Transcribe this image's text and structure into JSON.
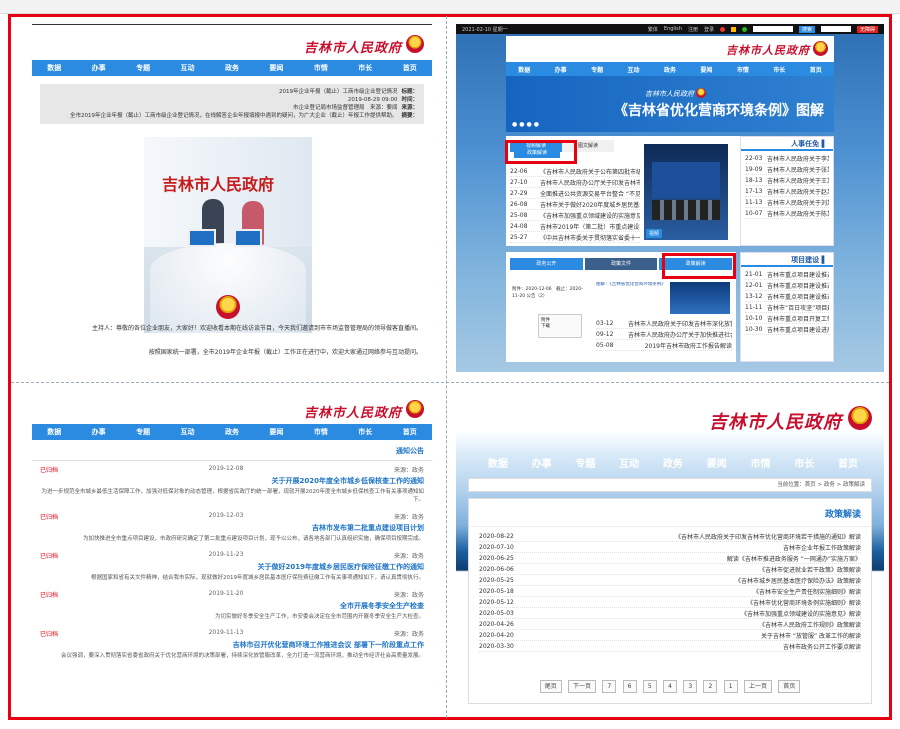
{
  "window": {
    "top_date": "2021-02-10 星期一"
  },
  "brand_name": "吉林市人民政府",
  "nav": [
    "首页",
    "市长",
    "市情",
    "要闻",
    "政务",
    "互动",
    "专题",
    "办事",
    "数据"
  ],
  "pane_tl": {
    "meta_labels": [
      "标题：",
      "时间：",
      "来源：",
      "摘要："
    ],
    "meta_values": [
      "2019年企业年报（截止）工商市级企业登记情况",
      "2019-08-29 09:00",
      "市企业登记局市场监督管理局　来源：要闻",
      "全市2019年企业年报（截止）工商市级企业登记情况，在线解答企业年报填报中遇到的疑问，为广大企业（截止）年报工作提供帮助。"
    ],
    "photo_sign": "吉林市人民政府",
    "para1": "主持人：尊敬的各位企业朋友，大家好！欢迎收看本期在线访谈节目，今天我们邀请到市市场监督管理局的领导做客直播间。",
    "para2": "按照国家统一部署，全市2019年企业年报（截止）工作正在进行中，欢迎大家通过网络参与互动提问。"
  },
  "pane_tr": {
    "top_links": [
      "无障碍",
      "长者版",
      "登录",
      "注册",
      "English",
      "繁体"
    ],
    "search_placeholder": "请输入关键字",
    "search_button": "搜索",
    "banner_caption": "《吉林省优化营商环境条例》图解",
    "left_tabs": [
      "政策解读",
      "图文解读",
      "视频解读"
    ],
    "news": [
      [
        "《吉林市人民政府关于公布第四批市级非物质文化遗产代表性项目名录的通知》",
        "22-06"
      ],
      [
        "吉林市人民政府办公厅关于印发吉林市优化营商环境工作方案的通知",
        "27-10"
      ],
      [
        "全面推进公共资源交易平台整合 “不见面”开标常态化",
        "27-29"
      ],
      [
        "吉林市关于做好2020年度城乡居民基本医疗保险参保工作的通知",
        "26-08"
      ],
      [
        "《吉林市加强重点领域建设的实施意见》政策解读",
        "25-08"
      ],
      [
        "吉林市2019年（第二批）市重点建设项目计划",
        "24-08"
      ],
      [
        "《中共吉林市委关于贯彻落实省委十一届五次全会精神的决定》",
        "25-27"
      ]
    ],
    "video_label": "视频",
    "side_title": "人事任免",
    "side_items": [
      [
        "吉林市人民政府关于李某某等同志职务任免的通知",
        "22-03"
      ],
      [
        "吉林市人民政府关于张某某等同志职务任免的通知",
        "19-09"
      ],
      [
        "吉林市人民政府关于王某某同志职务任免的通知",
        "18-13"
      ],
      [
        "吉林市人民政府关于赵某某等同志职务任免的通知",
        "17-13"
      ],
      [
        "吉林市人民政府关于刘某某等同志职务任免的通知",
        "11-13"
      ],
      [
        "吉林市人民政府关于陈某某同志职务任免的通知",
        "10-07"
      ]
    ],
    "tabs2": [
      "政务公开",
      "政策文件",
      "政策解读"
    ],
    "pill_label": "图解：《吉林省优化营商环境条例》",
    "tab2_items": [
      [
        "吉林市人民政府关于印发吉林市深化放管服改革工作方案的通知",
        "03-12"
      ],
      [
        "吉林市人民政府办公厅关于加快推进社会信用体系建设的实施意见",
        "09-12"
      ],
      [
        "2019年吉林市政府工作报告解读",
        "05-08"
      ]
    ],
    "mini_text": "附件：2020-12-06　截止：2020-11-20 公告（2）",
    "tiny_items": [
      "附件",
      "下载"
    ],
    "side2_title": "项目建设",
    "side2_items": [
      [
        "吉林市重点项目建设推进情况通报（第一期）",
        "21-01"
      ],
      [
        "吉林市重点项目建设推进情况通报（第二期）",
        "12-01"
      ],
      [
        "吉林市重点项目建设推进情况通报（第三期）",
        "13-12"
      ],
      [
        "吉林市“百日攻坚”项目建设成效显著",
        "11-11"
      ],
      [
        "吉林市重点项目开复工情况通报",
        "10-10"
      ],
      [
        "吉林市重点项目建设进展情况",
        "10-30"
      ]
    ]
  },
  "pane_bl": {
    "section_title": "通知公告",
    "tag": "已归档",
    "articles": [
      {
        "title": "关于开展2020年度全市城乡低保核查工作的通知",
        "source": "来源：政务",
        "date": "2019-12-08",
        "body": "为进一步规范全市城乡最低生活保障工作，加强对低保对象的动态管理，根据省民政厅的统一部署，现就开展2020年度全市城乡低保核查工作有关事项通知如下。"
      },
      {
        "title": "吉林市发布第二批重点建设项目计划",
        "source": "来源：政务",
        "date": "2019-12-03",
        "body": "为加快推进全市重点项目建设，市政府研究确定了第二批重点建设项目计划，现予以公布，请各地各部门认真组织实施，确保项目按期完成。"
      },
      {
        "title": "关于做好2019年度城乡居民医疗保险征缴工作的通知",
        "source": "来源：政务",
        "date": "2019-11-23",
        "body": "根据国家和省有关文件精神，结合我市实际，现就做好2019年度城乡居民基本医疗保险费征缴工作有关事项通知如下，请认真贯彻执行。"
      },
      {
        "title": "全市开展冬季安全生产检查",
        "source": "来源：政务",
        "date": "2019-11-20",
        "body": "为切实做好冬季安全生产工作，市安委会决定在全市范围内开展冬季安全生产大检查。"
      },
      {
        "title": "吉林市召开优化营商环境工作推进会议 部署下一阶段重点工作",
        "source": "来源：政务",
        "date": "2019-11-13",
        "body": "会议强调，要深入贯彻落实省委省政府关于优化营商环境的决策部署，持续深化放管服改革，全力打造一流营商环境，推动全市经济社会高质量发展。"
      }
    ]
  },
  "pane_br": {
    "crumb": "当前位置：首页 > 政务 > 政策解读",
    "list_title": "政策解读",
    "list": [
      [
        "《吉林市人民政府关于印发吉林市优化营商环境若干措施的通知》解读",
        "2020-08-22"
      ],
      [
        "吉林市企业年报工作政策解读",
        "2020-07-10"
      ],
      [
        "解读《吉林市推进政务服务 “一网通办”实施方案》",
        "2020-06-25"
      ],
      [
        "《吉林市促进就业若干政策》政策解读",
        "2020-06-06"
      ],
      [
        "《吉林市城乡居民基本医疗保险办法》政策解读",
        "2020-05-25"
      ],
      [
        "《吉林市安全生产责任制实施细则》解读",
        "2020-05-18"
      ],
      [
        "《吉林市优化营商环境条例实施细则》解读",
        "2020-05-12"
      ],
      [
        "《吉林市加强重点领域建设的实施意见》解读",
        "2020-05-03"
      ],
      [
        "《吉林市人民政府工作规则》政策解读",
        "2020-04-26"
      ],
      [
        "关于吉林市 “放管服” 改革工作的解读",
        "2020-04-20"
      ],
      [
        "吉林市政务公开工作要点解读",
        "2020-03-30"
      ]
    ],
    "pager": [
      "首页",
      "上一页",
      "1",
      "2",
      "3",
      "4",
      "5",
      "6",
      "7",
      "下一页",
      "尾页"
    ]
  }
}
